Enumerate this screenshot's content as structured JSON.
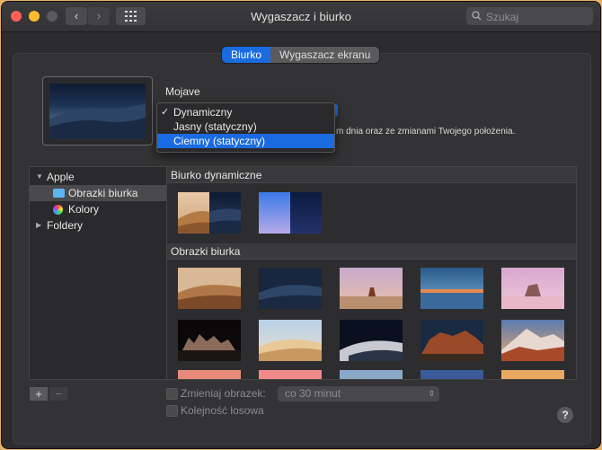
{
  "window": {
    "title": "Wygaszacz i biurko"
  },
  "toolbar": {
    "back_icon": "‹",
    "forward_icon": "›"
  },
  "search": {
    "placeholder": "Szukaj"
  },
  "tabs": [
    {
      "label": "Biurko",
      "active": true
    },
    {
      "label": "Wygaszacz ekranu",
      "active": false
    }
  ],
  "wallpaper": {
    "name": "Mojave",
    "description": "m dnia oraz ze zmianami Twojego położenia."
  },
  "dropdown": {
    "items": [
      {
        "label": "Dynamiczny",
        "checked": true,
        "selected": false
      },
      {
        "label": "Jasny (statyczny)",
        "checked": false,
        "selected": false
      },
      {
        "label": "Ciemny (statyczny)",
        "checked": false,
        "selected": true
      }
    ]
  },
  "sidebar": {
    "group": "Apple",
    "items": [
      {
        "label": "Obrazki biurka",
        "icon": "folder-icon",
        "selected": true
      },
      {
        "label": "Kolory",
        "icon": "color-wheel-icon",
        "selected": false
      }
    ],
    "folders": "Foldery"
  },
  "sections": {
    "dynamic": "Biurko dynamiczne",
    "pictures": "Obrazki biurka"
  },
  "controls": {
    "add": "+",
    "remove": "−",
    "change_picture": "Zmieniaj obrazek:",
    "interval": "co 30 minut",
    "random_order": "Kolejność losowa",
    "help": "?"
  },
  "colors": {
    "accent": "#1a6be0",
    "background": "#2c2c2e"
  }
}
